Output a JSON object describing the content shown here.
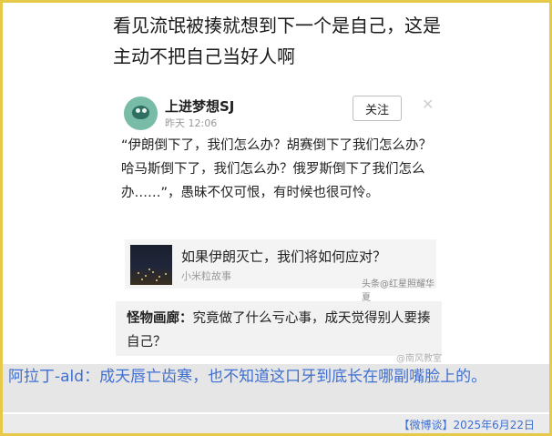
{
  "headline": "看见流氓被揍就想到下一个是自己，这是主动不把自己当好人啊",
  "post": {
    "username": "上进梦想SJ",
    "time": "昨天 12:06",
    "follow_label": "关注",
    "close_glyph": "✕",
    "body": "“伊朗倒下了，我们怎么办？胡赛倒下了我们怎么办？哈马斯倒下了，我们怎么办？俄罗斯倒下了我们怎么办……”，愚昧不仅可恨，有时候也很可怜。",
    "link_card": {
      "title": "如果伊朗灭亡，我们将如何应对？",
      "source": "小米粒故事"
    },
    "watermark": "头条@红星照耀华夏"
  },
  "comment": {
    "author": "怪物画廊",
    "separator": "：",
    "text": "究竟做了什么亏心事，成天觉得别人要揍自己？"
  },
  "weibo_watermark": "@南风教室",
  "bottom_comment": "阿拉丁-ald：成天唇亡齿寒，也不知道这口牙到底长在哪副嘴脸上的。",
  "footer": "【微博谈】2025年6月22日",
  "colors": {
    "frame_border": "#e7c94a",
    "bottom_text": "#3f6fd1",
    "avatar": "#78bca7"
  }
}
